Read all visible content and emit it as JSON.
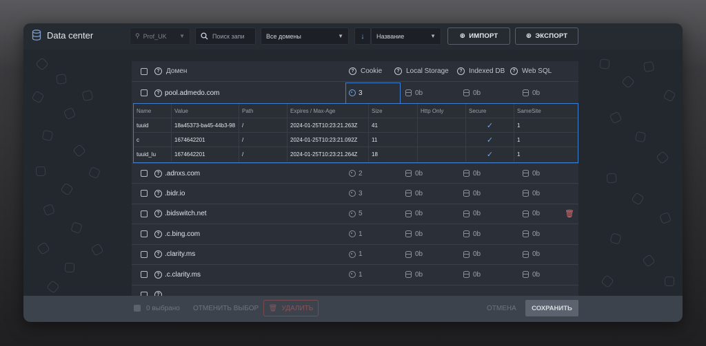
{
  "app": {
    "title": "Data center"
  },
  "header": {
    "profile_select": "Prof_UK",
    "search_placeholder": "Поиск запи",
    "domains_select": "Все домены",
    "sort_select": "Название",
    "import_label": "ИМПОРТ",
    "export_label": "ЭКСПОРТ"
  },
  "table": {
    "columns": {
      "domain": "Домен",
      "cookie": "Cookie",
      "local_storage": "Local Storage",
      "indexed_db": "Indexed DB",
      "web_sql": "Web SQL"
    },
    "expanded": {
      "domain": "pool.admedo.com",
      "cookie": "3",
      "local_storage": "0b",
      "indexed_db": "0b",
      "web_sql": "0b",
      "sub_columns": [
        "Name",
        "Value",
        "Path",
        "Expires / Max-Age",
        "Size",
        "Http Only",
        "Secure",
        "SameSite"
      ],
      "sub_rows": [
        {
          "name": "tuuid",
          "value": "18a45373-ba45-44b3-98",
          "path": "/",
          "expires": "2024-01-25T10:23:21.263Z",
          "size": "41",
          "http_only": "",
          "secure": "✓",
          "samesite": "1"
        },
        {
          "name": "c",
          "value": "1674642201",
          "path": "/",
          "expires": "2024-01-25T10:23:21.092Z",
          "size": "11",
          "http_only": "",
          "secure": "✓",
          "samesite": "1"
        },
        {
          "name": "tuuid_lu",
          "value": "1674642201",
          "path": "/",
          "expires": "2024-01-25T10:23:21.264Z",
          "size": "18",
          "http_only": "",
          "secure": "✓",
          "samesite": "1"
        }
      ]
    },
    "rows": [
      {
        "domain": ".adnxs.com",
        "cookie": "2",
        "local_storage": "0b",
        "indexed_db": "0b",
        "web_sql": "0b"
      },
      {
        "domain": ".bidr.io",
        "cookie": "3",
        "local_storage": "0b",
        "indexed_db": "0b",
        "web_sql": "0b"
      },
      {
        "domain": ".bidswitch.net",
        "cookie": "5",
        "local_storage": "0b",
        "indexed_db": "0b",
        "web_sql": "0b"
      },
      {
        "domain": ".c.bing.com",
        "cookie": "1",
        "local_storage": "0b",
        "indexed_db": "0b",
        "web_sql": "0b"
      },
      {
        "domain": ".clarity.ms",
        "cookie": "1",
        "local_storage": "0b",
        "indexed_db": "0b",
        "web_sql": "0b"
      },
      {
        "domain": ".c.clarity.ms",
        "cookie": "1",
        "local_storage": "0b",
        "indexed_db": "0b",
        "web_sql": "0b"
      }
    ]
  },
  "footer": {
    "selected_label": "0 выбрано",
    "deselect_label": "ОТМЕНИТЬ ВЫБОР",
    "delete_label": "УДАЛИТЬ",
    "cancel_label": "ОТМЕНА",
    "save_label": "СОХРАНИТЬ"
  },
  "colors": {
    "accent": "#3d7fd1",
    "danger": "#e06a6a",
    "background": "#262a31"
  }
}
